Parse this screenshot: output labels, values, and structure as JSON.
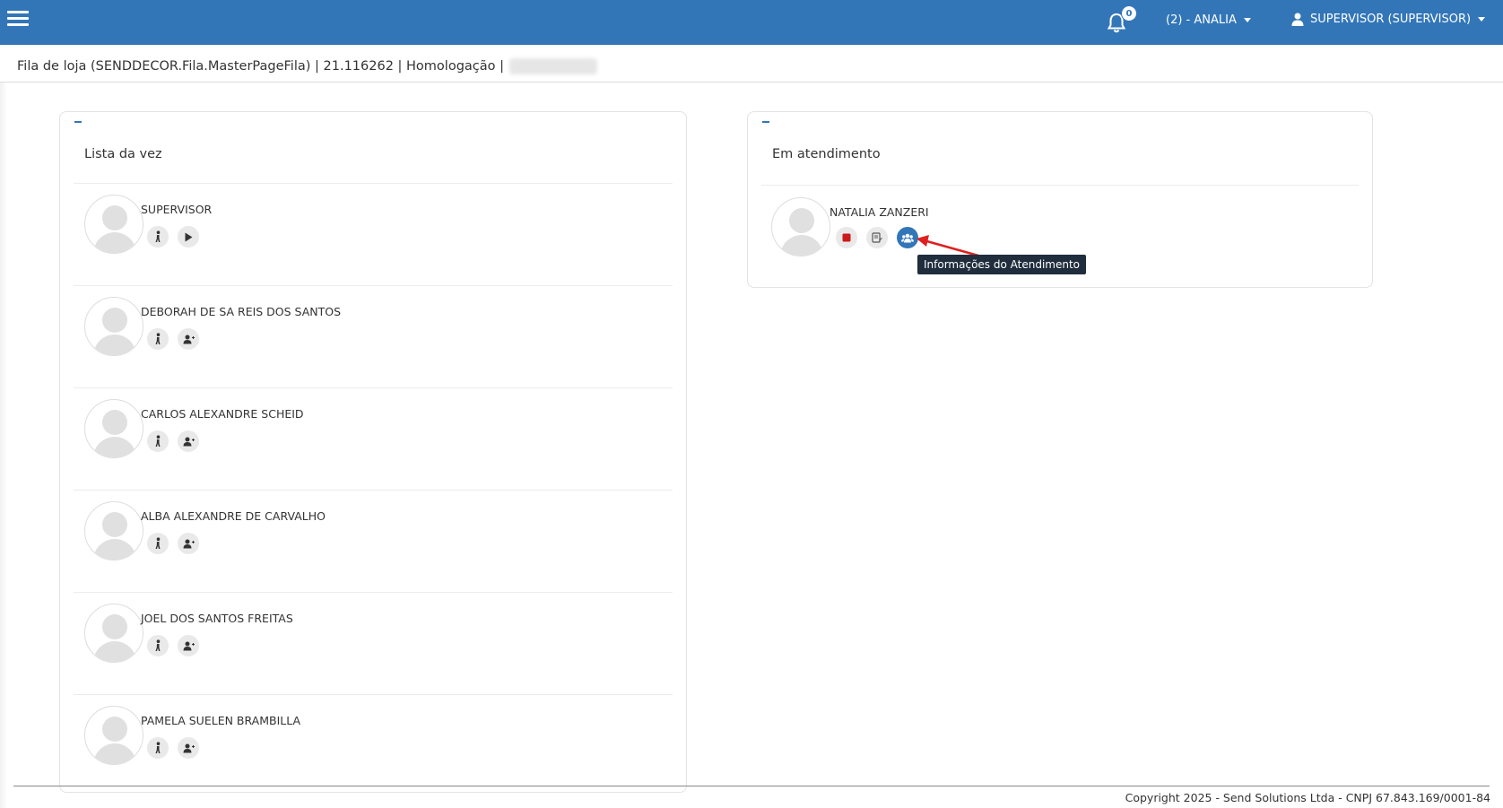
{
  "header": {
    "notification_count": "0",
    "store_label": "(2) - ANALIA",
    "user_label": "SUPERVISOR (SUPERVISOR)",
    "color": "#3276b8"
  },
  "titlebar": {
    "text": "Fila de loja (SENDDECOR.Fila.MasterPageFila) | 21.116262 | Homologação |"
  },
  "queue_panel": {
    "title": "Lista da vez",
    "items": [
      {
        "name": "SUPERVISOR",
        "actions": [
          "walk-icon",
          "play-icon"
        ]
      },
      {
        "name": "DEBORAH DE SA REIS DOS SANTOS",
        "actions": [
          "walk-icon",
          "user-plus-icon"
        ]
      },
      {
        "name": "CARLOS ALEXANDRE SCHEID",
        "actions": [
          "walk-icon",
          "user-plus-icon"
        ]
      },
      {
        "name": "ALBA ALEXANDRE DE CARVALHO",
        "actions": [
          "walk-icon",
          "user-plus-icon"
        ]
      },
      {
        "name": "JOEL DOS SANTOS FREITAS",
        "actions": [
          "walk-icon",
          "user-plus-icon"
        ]
      },
      {
        "name": "PAMELA SUELEN BRAMBILLA",
        "actions": [
          "walk-icon",
          "user-plus-icon"
        ]
      }
    ]
  },
  "attending_panel": {
    "title": "Em atendimento",
    "items": [
      {
        "name": "NATALIA ZANZERI",
        "actions": [
          "stop-icon",
          "notes-icon",
          "users-icon"
        ]
      }
    ]
  },
  "tooltip": {
    "text": "Informações do Atendimento"
  },
  "footer": {
    "text": "Copyright 2025 - Send Solutions Ltda - CNPJ 67.843.169/0001-84"
  }
}
